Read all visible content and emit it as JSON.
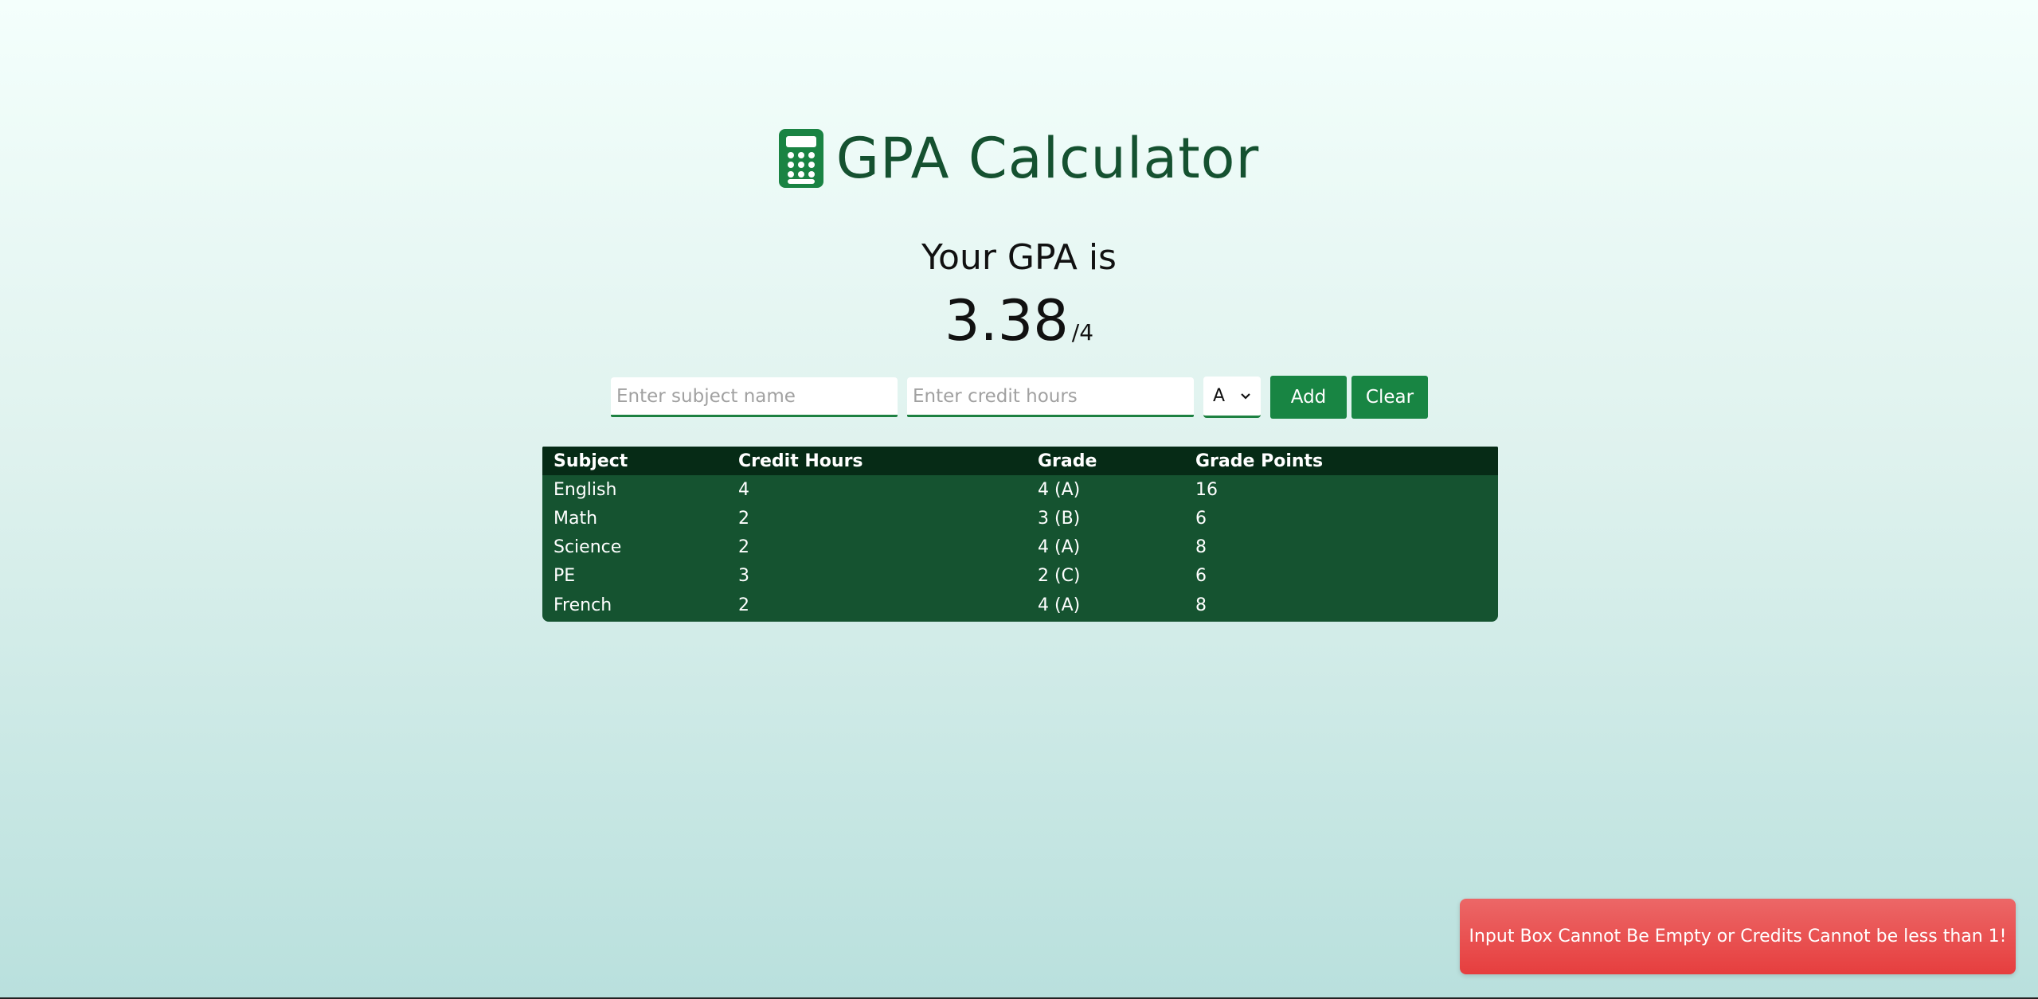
{
  "header": {
    "title": "GPA Calculator",
    "icon": "calculator-icon"
  },
  "summary": {
    "label": "Your GPA is",
    "value": "3.38",
    "max": "/4"
  },
  "form": {
    "subject_placeholder": "Enter subject name",
    "subject_value": "",
    "credit_placeholder": "Enter credit hours",
    "credit_value": "",
    "grade_selected": "A",
    "add_label": "Add",
    "clear_label": "Clear"
  },
  "table": {
    "headers": [
      "Subject",
      "Credit Hours",
      "Grade",
      "Grade Points"
    ],
    "rows": [
      [
        "English",
        "4",
        "4 (A)",
        "16"
      ],
      [
        "Math",
        "2",
        "3 (B)",
        "6"
      ],
      [
        "Science",
        "2",
        "4 (A)",
        "8"
      ],
      [
        "PE",
        "3",
        "2 (C)",
        "6"
      ],
      [
        "French",
        "2",
        "4 (A)",
        "8"
      ]
    ]
  },
  "toast": {
    "message": "Input Box Cannot Be Empty or Credits Cannot be less than 1!"
  },
  "colors": {
    "accent": "#188543",
    "title": "#155130",
    "table_head": "#062b16",
    "table_body": "#155330",
    "toast": "#e63e3e"
  }
}
